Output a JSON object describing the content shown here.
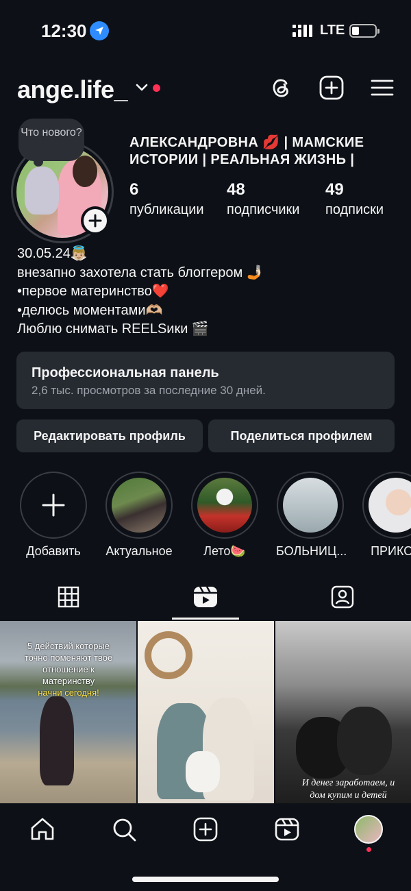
{
  "status_bar": {
    "time": "12:30",
    "network": "LTE",
    "battery_level": 0.2
  },
  "header": {
    "username": "ange.life_",
    "icons": [
      "chevron-down-icon",
      "threads-icon",
      "create-post-icon",
      "menu-icon"
    ],
    "accent_color": "#ff2f55"
  },
  "profile": {
    "note_bubble": "Что нового?",
    "full_name": "АЛЕКСАНДРОВНА 💋 | МАМСКИЕ ИСТОРИИ | РЕАЛЬНАЯ ЖИЗНЬ |",
    "stats": [
      {
        "value": "6",
        "label": "публикации"
      },
      {
        "value": "48",
        "label": "подписчики"
      },
      {
        "value": "49",
        "label": "подписки"
      }
    ],
    "bio": [
      "30.05.24👼🏼",
      "внезапно захотела стать блоггером 🤳🏻",
      "•первое материнство❤️",
      "•делюсь моментами🫶🏼",
      "Люблю снимать REELSики 🎬"
    ]
  },
  "pro_panel": {
    "title": "Профессиональная панель",
    "subtitle": "2,6 тыс. просмотров за последние 30 дней."
  },
  "actions": {
    "edit_profile": "Редактировать профиль",
    "share_profile": "Поделиться профилем"
  },
  "highlights": [
    {
      "label": "Добавить"
    },
    {
      "label": "Актуальное"
    },
    {
      "label": "Лето🍉"
    },
    {
      "label": "БОЛЬНИЦ..."
    },
    {
      "label": "ПРИКОЛ"
    }
  ],
  "tabs": {
    "active": "reels",
    "items": [
      "grid-icon",
      "reels-icon",
      "tagged-icon"
    ]
  },
  "grid": [
    {
      "caption_lines": [
        "5 действий которые",
        "точно поменяют твое",
        "отношение к",
        "материнству"
      ],
      "caption_highlight": "начни сегодня!"
    },
    {
      "caption": ""
    },
    {
      "caption_lines": [
        "И денег заработаем, и",
        "дом купим и детей"
      ]
    }
  ],
  "bottom_nav": [
    "home-icon",
    "search-icon",
    "create-icon",
    "reels-icon",
    "profile-avatar"
  ]
}
